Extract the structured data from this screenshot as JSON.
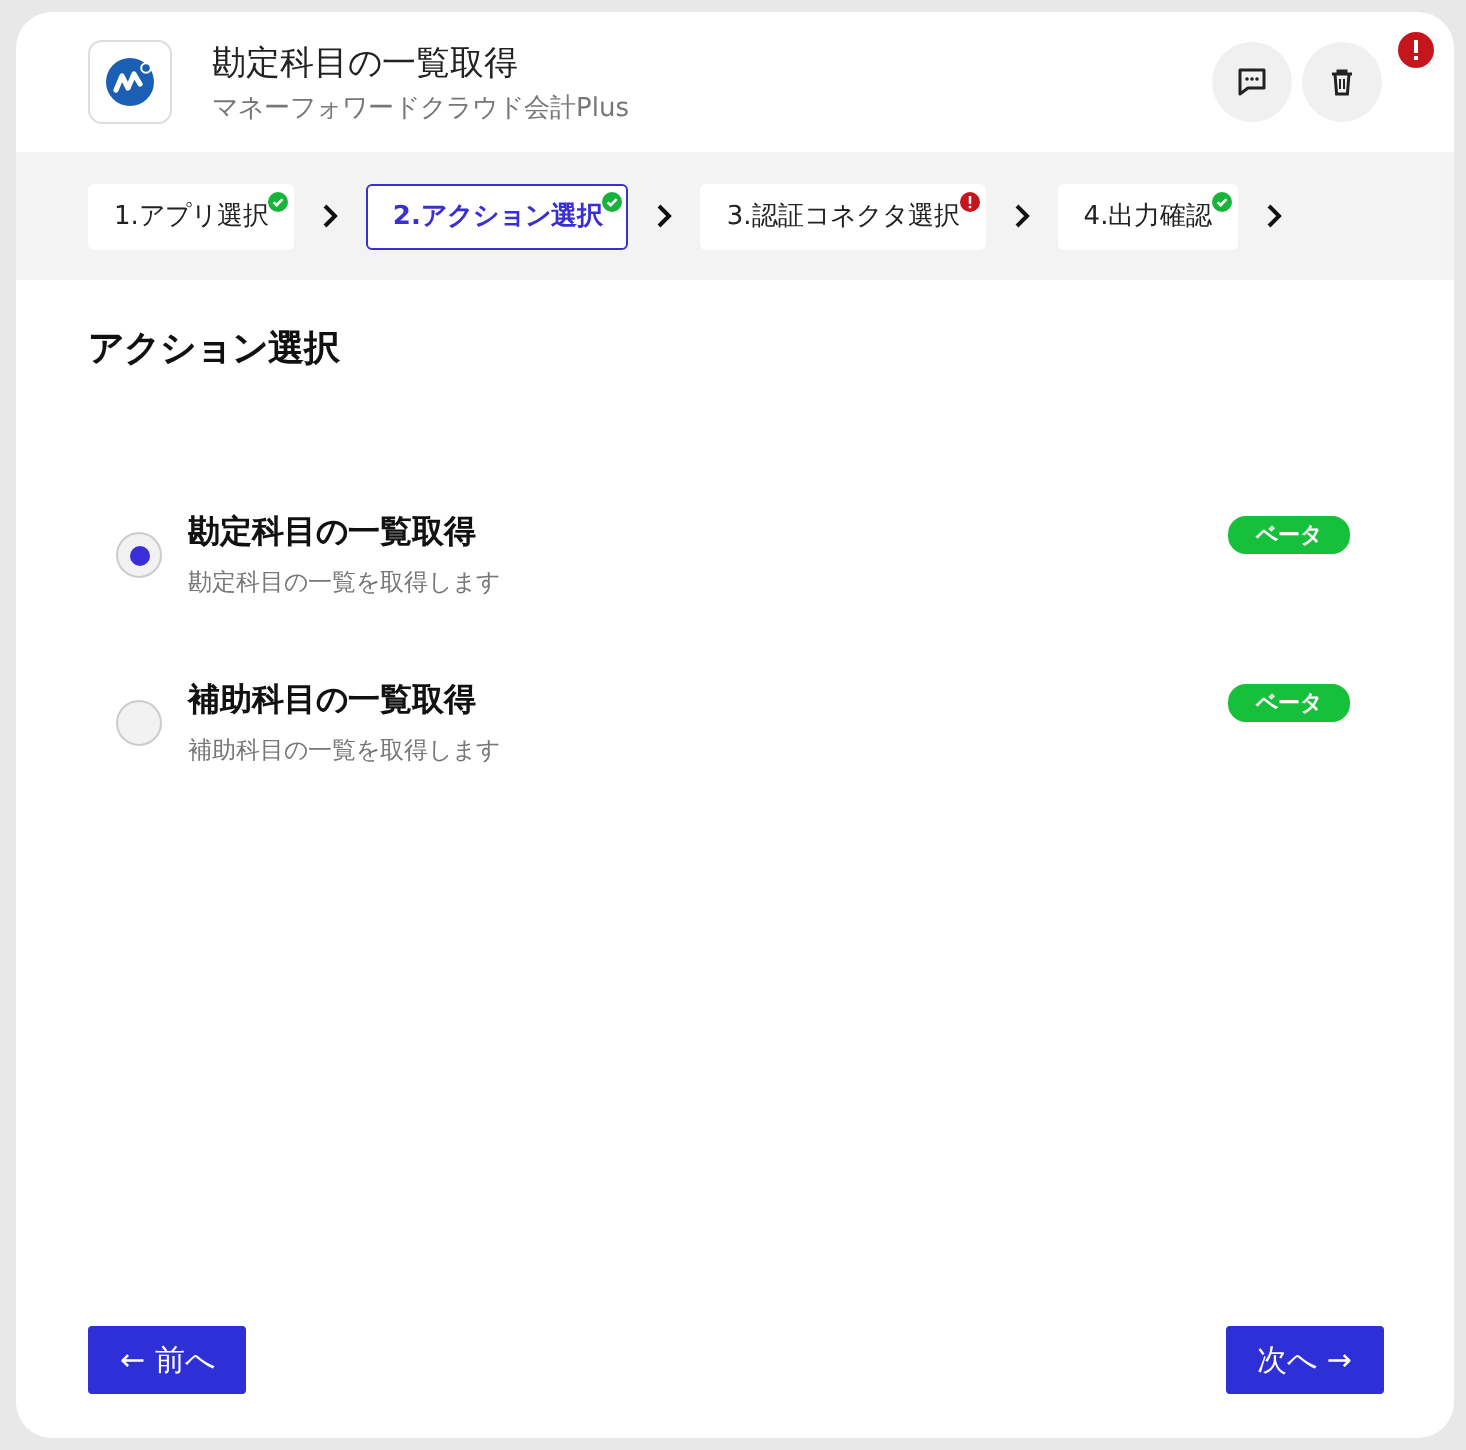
{
  "header": {
    "title": "勘定科目の一覧取得",
    "subtitle": "マネーフォワードクラウド会計Plus",
    "has_error": true
  },
  "steps": [
    {
      "label": "1.アプリ選択",
      "selected": false,
      "error": false
    },
    {
      "label": "2.アクション選択",
      "selected": true,
      "error": false
    },
    {
      "label": "3.認証コネクタ選択",
      "selected": false,
      "error": true
    },
    {
      "label": "4.出力確認",
      "selected": false,
      "error": false
    }
  ],
  "section_title": "アクション選択",
  "actions": [
    {
      "title": "勘定科目の一覧取得",
      "description": "勘定科目の一覧を取得します",
      "badge": "ベータ",
      "selected": true
    },
    {
      "title": "補助科目の一覧取得",
      "description": "補助科目の一覧を取得します",
      "badge": "ベータ",
      "selected": false
    }
  ],
  "buttons": {
    "back": "← 前へ",
    "next": "次へ →"
  }
}
